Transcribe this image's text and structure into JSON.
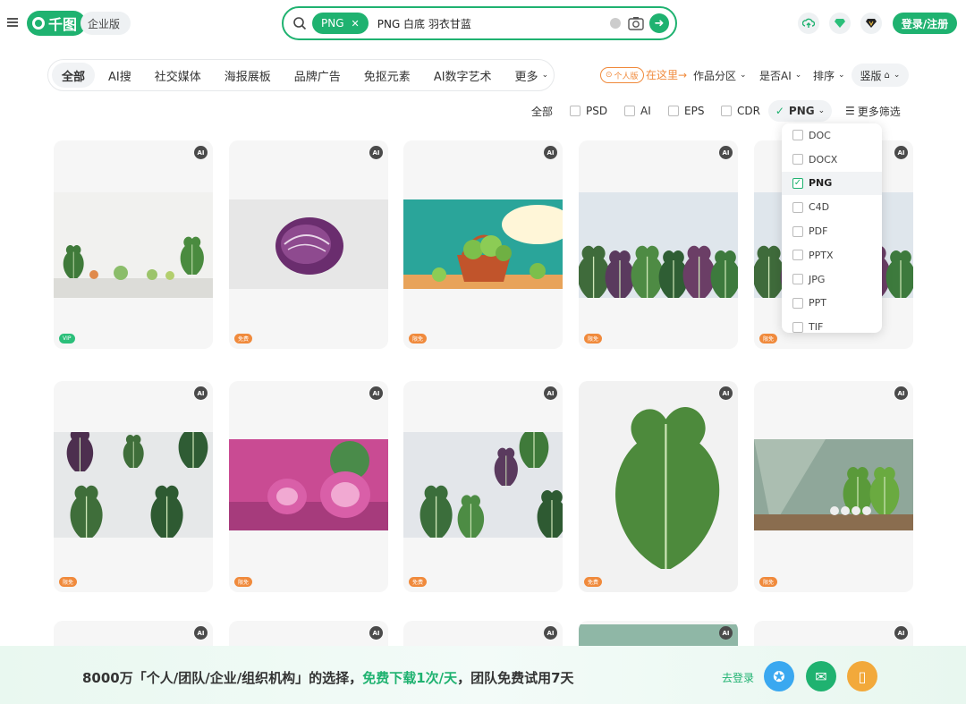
{
  "header": {
    "logo_text": "千图",
    "enterprise_label": "企业版",
    "search_chip": "PNG",
    "search_chip_close": "✕",
    "search_query": "PNG 白底 羽衣甘蓝",
    "login_label": "登录/注册"
  },
  "tabs": [
    {
      "label": "全部"
    },
    {
      "label": "AI搜"
    },
    {
      "label": "社交媒体"
    },
    {
      "label": "海报展板"
    },
    {
      "label": "品牌广告"
    },
    {
      "label": "免抠元素"
    },
    {
      "label": "AI数字艺术"
    },
    {
      "label": "更多"
    }
  ],
  "filters": {
    "personal_badge": "个人版",
    "here_text": "在这里→",
    "category": "作品分区",
    "is_ai": "是否AI",
    "sort": "排序",
    "layout": "竖版"
  },
  "formats": {
    "all": "全部",
    "items": [
      "PSD",
      "AI",
      "EPS",
      "CDR"
    ],
    "selected": "PNG",
    "more": "更多筛选"
  },
  "dropdown": {
    "items": [
      {
        "label": "DOC",
        "checked": false
      },
      {
        "label": "DOCX",
        "checked": false
      },
      {
        "label": "PNG",
        "checked": true
      },
      {
        "label": "C4D",
        "checked": false
      },
      {
        "label": "PDF",
        "checked": false
      },
      {
        "label": "PPTX",
        "checked": false
      },
      {
        "label": "JPG",
        "checked": false
      },
      {
        "label": "PPT",
        "checked": false
      },
      {
        "label": "TIF",
        "checked": false
      }
    ]
  },
  "cards": [
    {
      "ai": "AI",
      "badge": "VIP",
      "badge_type": "vip",
      "scene": "kitchen-shelf"
    },
    {
      "ai": "AI",
      "badge": "免费",
      "badge_type": "free",
      "scene": "purple-cabbage"
    },
    {
      "ai": "AI",
      "badge": "限免",
      "badge_type": "free",
      "scene": "basket"
    },
    {
      "ai": "AI",
      "badge": "限免",
      "badge_type": "free",
      "scene": "kale-row"
    },
    {
      "ai": "AI",
      "badge": "限免",
      "badge_type": "free",
      "scene": "kale-row2"
    },
    {
      "ai": "AI",
      "badge": "限免",
      "badge_type": "free",
      "scene": "kale-flat"
    },
    {
      "ai": "AI",
      "badge": "限免",
      "badge_type": "free",
      "scene": "pink-cabbage"
    },
    {
      "ai": "AI",
      "badge": "免费",
      "badge_type": "free",
      "scene": "kale-corner"
    },
    {
      "ai": "AI",
      "badge": "免费",
      "badge_type": "free",
      "scene": "kale-single"
    },
    {
      "ai": "AI",
      "badge": "限免",
      "badge_type": "free",
      "scene": "greens-light"
    },
    {
      "ai": "AI",
      "badge": "",
      "badge_type": "free",
      "scene": "partial"
    },
    {
      "ai": "AI",
      "badge": "",
      "badge_type": "free",
      "scene": "partial"
    },
    {
      "ai": "AI",
      "badge": "",
      "badge_type": "free",
      "scene": "partial"
    },
    {
      "ai": "AI",
      "badge": "",
      "badge_type": "free",
      "scene": "partial-green"
    },
    {
      "ai": "AI",
      "badge": "",
      "badge_type": "free",
      "scene": "partial"
    }
  ],
  "footer": {
    "text_a": "8000万「个人/团队/企业/组织机构」的选择，",
    "text_b": "免费下载1次/天",
    "text_c": "，团队免费试用7天",
    "login": "去登录"
  },
  "colors": {
    "brand": "#1fb270",
    "orange": "#f08a3c"
  }
}
